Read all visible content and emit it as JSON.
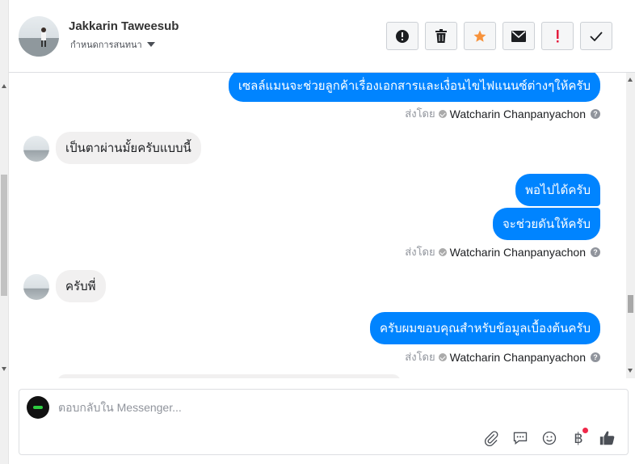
{
  "header": {
    "contact_name": "Jakkarin Taweesub",
    "manage_label": "กำหนดการสนทนา",
    "actions": [
      {
        "name": "report-button",
        "icon": "exclamation-circle-icon"
      },
      {
        "name": "delete-button",
        "icon": "trash-icon"
      },
      {
        "name": "star-button",
        "icon": "star-icon"
      },
      {
        "name": "mark-unread-button",
        "icon": "envelope-icon"
      },
      {
        "name": "spam-button",
        "icon": "exclamation-icon"
      },
      {
        "name": "mark-done-button",
        "icon": "checkmark-icon"
      }
    ]
  },
  "messages": {
    "m1": "เซลล์แมนจะช่วยลูกค้าเรื่องเอกสารและเงื่อนไขไฟแนนซ์ต่างๆให้ครับ",
    "m2": "เป็นตาผ่านมั้ยครับแบบนี้",
    "m3": "พอไปได้ครับ",
    "m4": "จะช่วยดันให้ครับ",
    "m5": "ครับพี่",
    "m6": "ครับผมขอบคุณสำหรับข้อมูลเบื้องต้นครับ",
    "sent_by_prefix": "ส่งโดย",
    "sender": "Watcharin Chanpanyachon",
    "help": "?"
  },
  "composer": {
    "placeholder": "ตอบกลับใน Messenger...",
    "currency_symbol": "฿"
  },
  "colors": {
    "outgoing_bubble": "#0084ff",
    "incoming_bubble": "#f1f0f0",
    "star": "#f7923b",
    "spam": "#e41e3f"
  }
}
